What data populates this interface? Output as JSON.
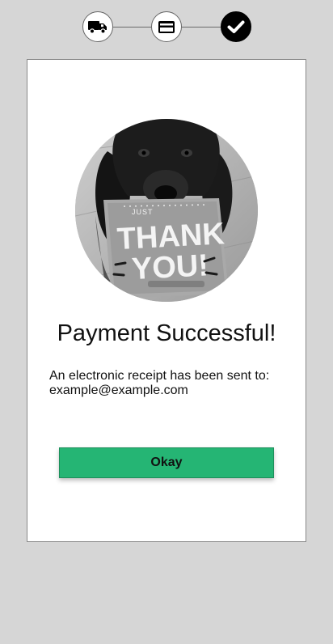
{
  "stepper": {
    "steps": [
      {
        "icon": "truck-icon",
        "state": "done"
      },
      {
        "icon": "credit-card-icon",
        "state": "done"
      },
      {
        "icon": "checkmark-icon",
        "state": "current"
      }
    ]
  },
  "card": {
    "image": {
      "card_text_small": "JUST",
      "card_text_line1": "THANK",
      "card_text_line2": "YOU!"
    },
    "title": "Payment Successful!",
    "message_line1": "An electronic receipt has been sent to:",
    "message_line2": "example@example.com",
    "okay_label": "Okay"
  },
  "colors": {
    "background": "#d6d6d6",
    "card": "#ffffff",
    "button": "#25b574",
    "active_step": "#000000"
  }
}
